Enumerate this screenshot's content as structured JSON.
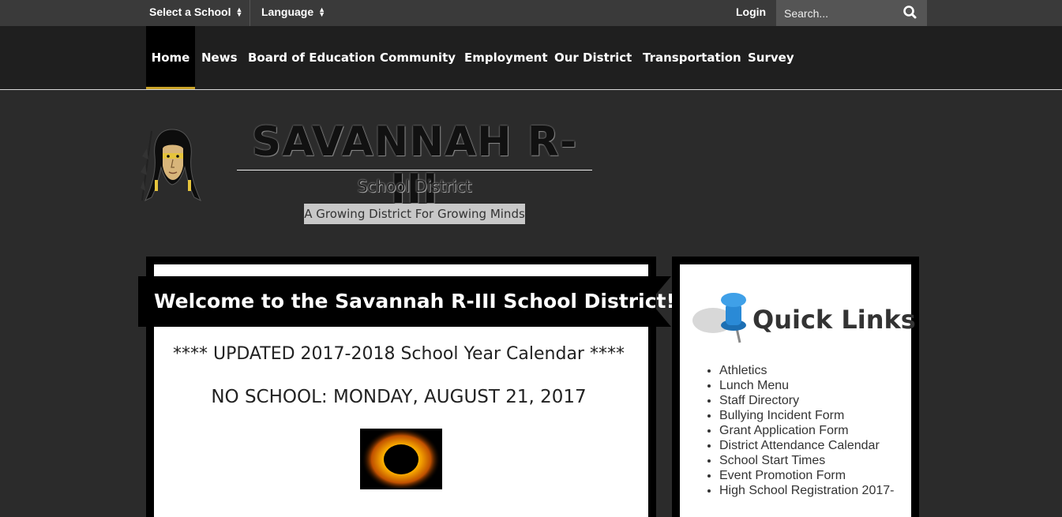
{
  "topbar": {
    "select_school": "Select a School",
    "language": "Language",
    "login": "Login",
    "search_placeholder": "Search..."
  },
  "nav": {
    "items": [
      {
        "label": "Home",
        "active": true
      },
      {
        "label": "News"
      },
      {
        "label": "Board of Education"
      },
      {
        "label": "Community"
      },
      {
        "label": "Employment"
      },
      {
        "label": "Our District"
      },
      {
        "label": "Transportation"
      },
      {
        "label": "Survey"
      }
    ]
  },
  "header": {
    "title": "SAVANNAH R-III",
    "subtitle": "School District",
    "tagline": "A Growing District For Growing Minds"
  },
  "main": {
    "welcome": "Welcome to the Savannah R-III School District!",
    "calendar_line": "**** UPDATED 2017-2018 School Year Calendar ****",
    "no_school": "NO SCHOOL: MONDAY, AUGUST 21, 2017"
  },
  "quick_links": {
    "title": "Quick Links",
    "items": [
      "Athletics",
      "Lunch Menu",
      "Staff Directory",
      "Bullying Incident Form",
      "Grant Application Form",
      "District Attendance Calendar",
      "School Start Times",
      "Event Promotion Form",
      "High School Registration 2017-"
    ]
  },
  "colors": {
    "accent": "#c9a227",
    "topbar_bg": "#3a3a3a",
    "nav_bg": "#1f1f1f",
    "page_bg": "#2b2b2b"
  },
  "icons": [
    "sort-caret-icon",
    "search-icon",
    "pushpin-icon",
    "school-mascot-logo"
  ]
}
